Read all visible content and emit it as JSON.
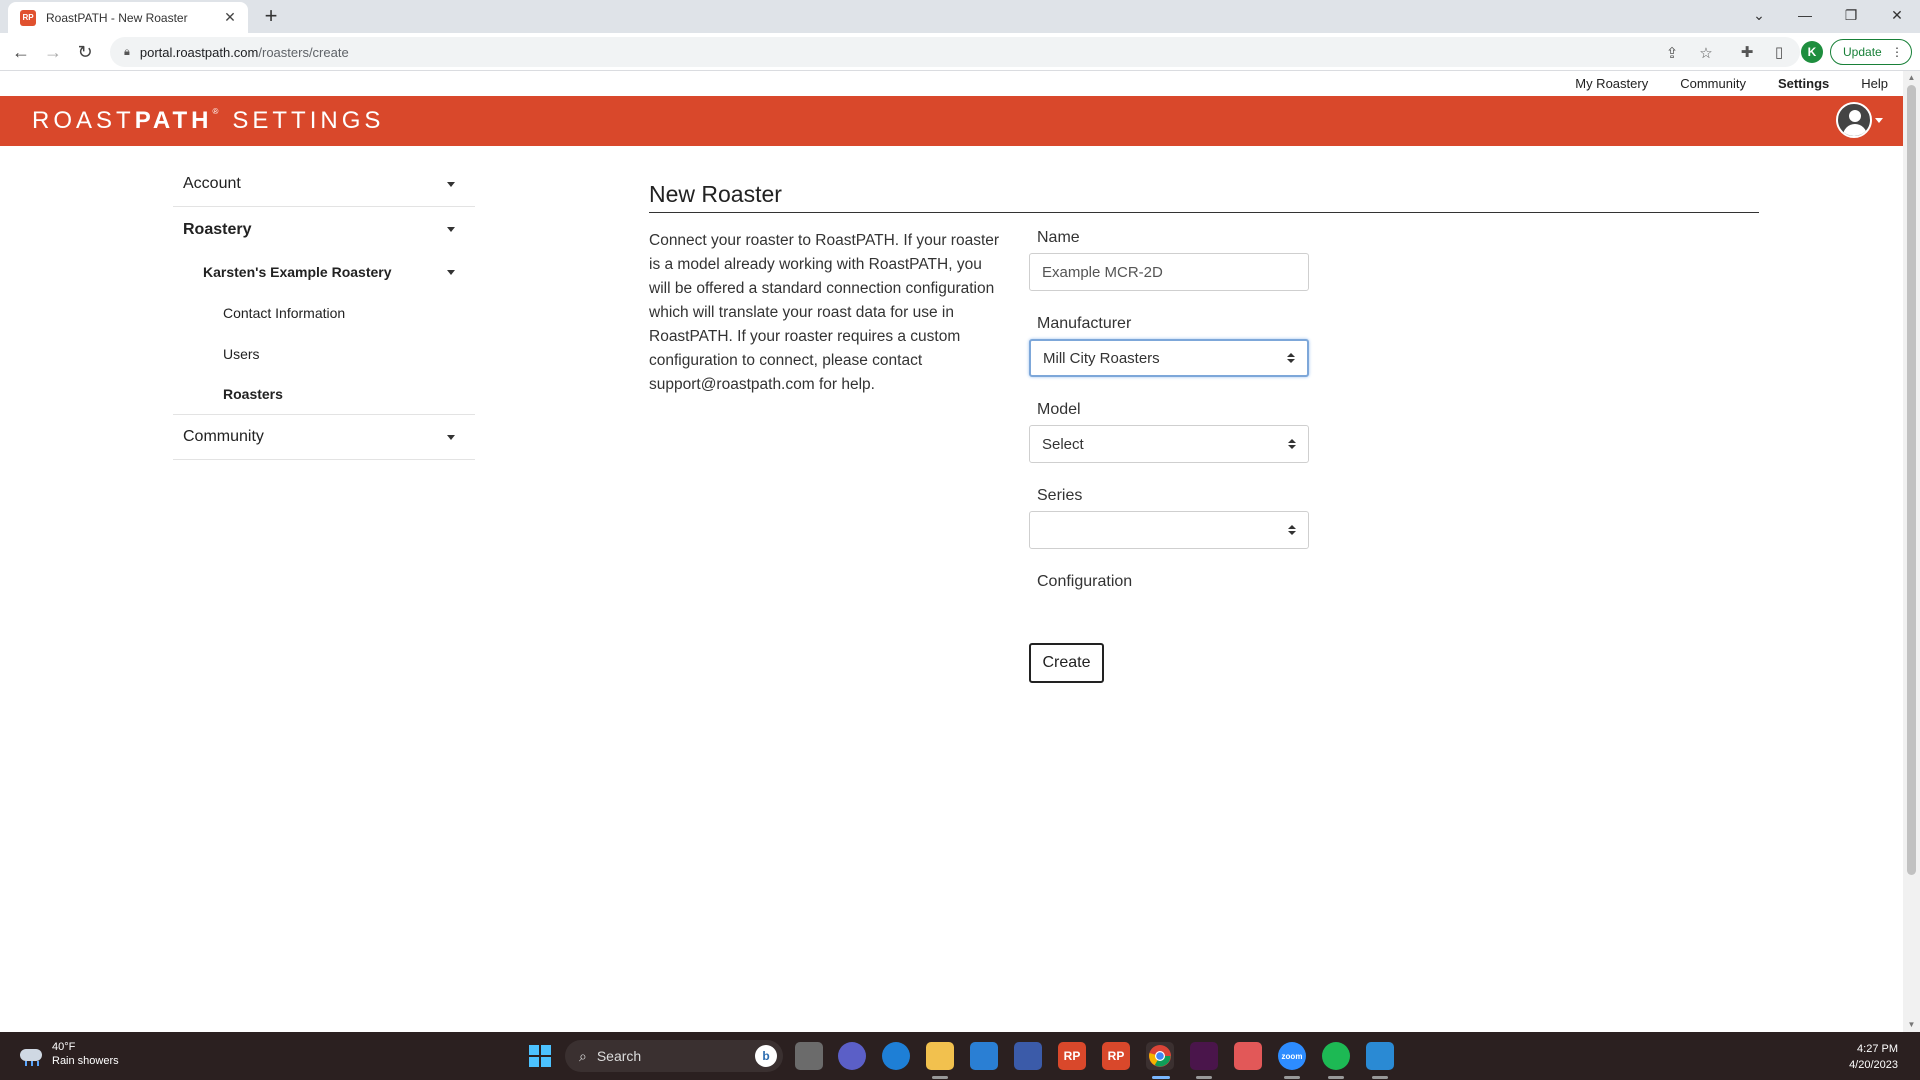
{
  "browser": {
    "tab_title": "RoastPATH - New Roaster",
    "favicon_text": "RP",
    "url_host": "portal.roastpath.com",
    "url_path": "/roasters/create",
    "profile_initial": "K",
    "update_label": "Update"
  },
  "topnav": {
    "my_roastery": "My Roastery",
    "community": "Community",
    "settings": "Settings",
    "help": "Help"
  },
  "banner": {
    "brand_part1": "ROAST",
    "brand_part2": "PATH",
    "brand_tm": "®",
    "brand_section": "SETTINGS",
    "accent_color": "#d9482b"
  },
  "sidebar": {
    "account": "Account",
    "roastery": "Roastery",
    "roastery_name": "Karsten's Example Roastery",
    "contact_information": "Contact Information",
    "users": "Users",
    "roasters": "Roasters",
    "community": "Community"
  },
  "main": {
    "title": "New Roaster",
    "description": "Connect your roaster to RoastPATH. If your roaster is a model already working with RoastPATH, you will be offered a standard connection configuration which will translate your roast data for use in RoastPATH. If your roaster requires a custom configuration to connect, please contact support@roastpath.com for help."
  },
  "form": {
    "name_label": "Name",
    "name_value": "Example MCR-2D",
    "manufacturer_label": "Manufacturer",
    "manufacturer_value": "Mill City Roasters",
    "model_label": "Model",
    "model_value": "Select",
    "series_label": "Series",
    "series_value": "",
    "configuration_label": "Configuration",
    "create_label": "Create"
  },
  "taskbar": {
    "weather_temp": "40°F",
    "weather_desc": "Rain showers",
    "search_label": "Search",
    "bing_glyph": "b",
    "rp_label_1": "RP",
    "rp_label_2": "RP",
    "zoom_label": "zoom",
    "time": "4:27 PM",
    "date": "4/20/2023"
  }
}
